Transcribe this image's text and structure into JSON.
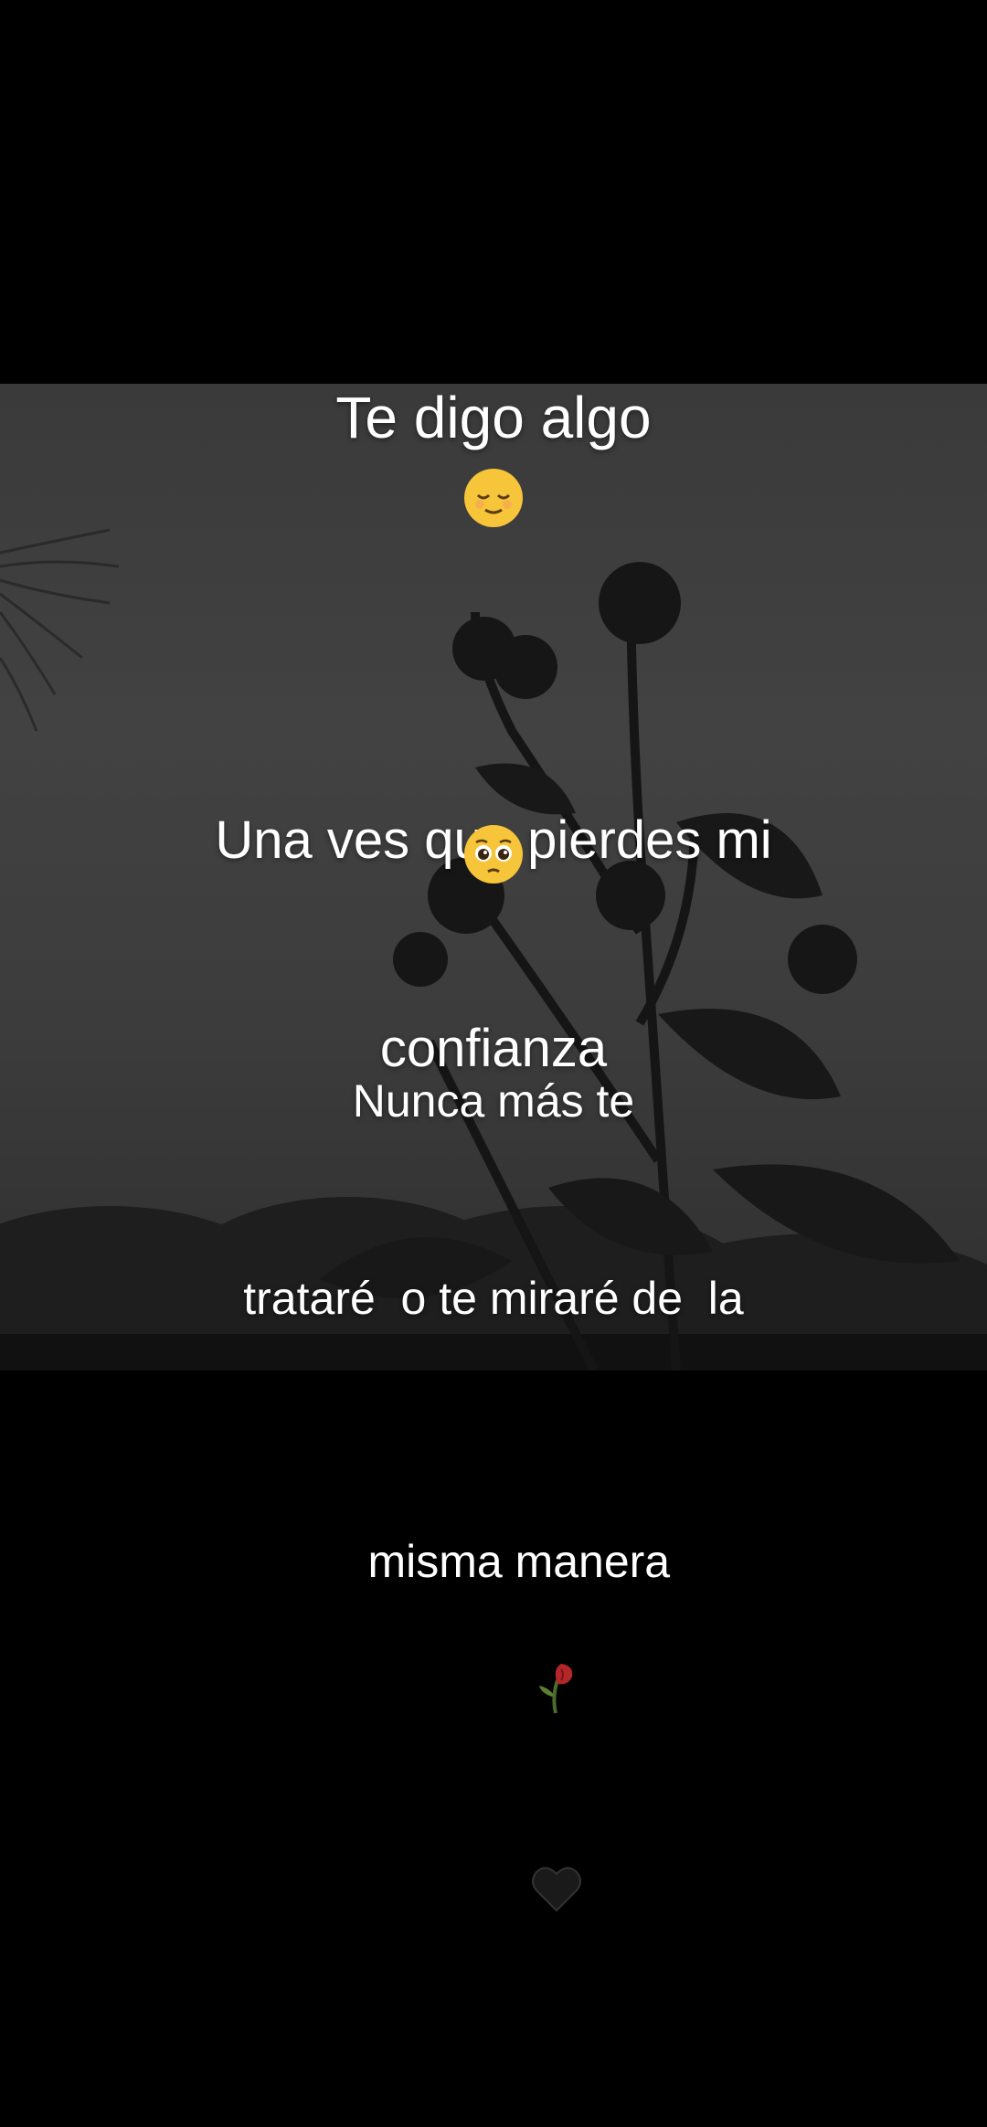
{
  "caption": {
    "line1": "Te digo algo",
    "emoji1": "relieved-face-emoji",
    "line2a": "Una ves que pierdes mi",
    "line2b": "confianza",
    "emoji2": "pleading-face-emoji",
    "line3a": "Nunca más te",
    "line3b": "trataré  o te miraré de  la",
    "line3c": "misma manera",
    "emoji3": [
      "wilted-rose-emoji",
      "black-heart-emoji"
    ]
  },
  "background": {
    "description_colors": {
      "sky": "#3f3f3f",
      "silhouette": "#141414",
      "letterbox": "#000000"
    }
  }
}
